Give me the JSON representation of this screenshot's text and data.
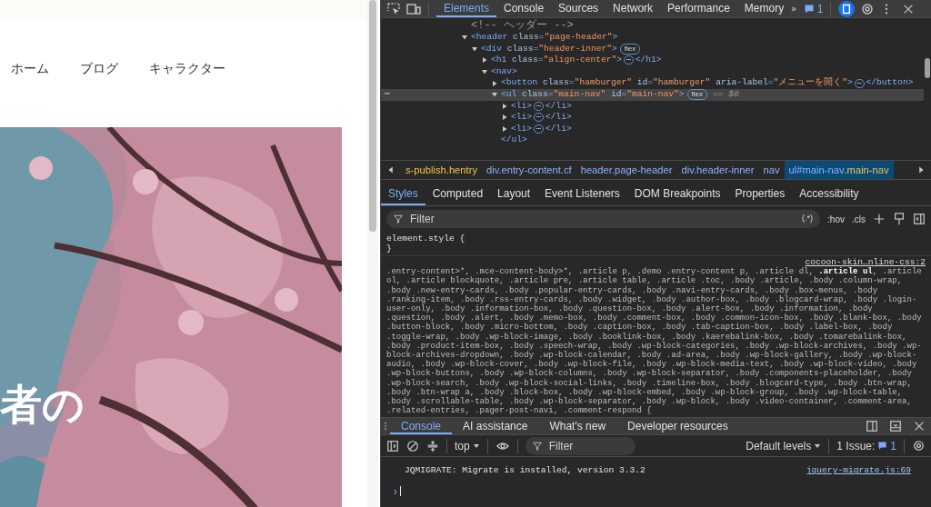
{
  "page": {
    "nav_items": [
      "ホーム",
      "ブログ",
      "キャラクター"
    ],
    "hero": {
      "kind": "picture",
      "title": "者の"
    }
  },
  "devtools": {
    "main_tabs": [
      {
        "label": "Elements",
        "selected": true
      },
      {
        "label": "Console",
        "selected": false
      },
      {
        "label": "Sources",
        "selected": false
      },
      {
        "label": "Network",
        "selected": false
      },
      {
        "label": "Performance",
        "selected": false
      },
      {
        "label": "Memory",
        "selected": false
      }
    ],
    "more_tabs": "»",
    "issues_count": "1",
    "dom_tree": [
      {
        "open": "<!-- ヘッダー -->",
        "kind": "comment"
      },
      {
        "open": "<header class=\"page-header\">",
        "kind": "element",
        "expanded": true,
        "selected": false,
        "children": [
          {
            "open": "<div class=\"header-inner\">",
            "kind": "element",
            "expanded": true,
            "selected": false,
            "badge": "flex",
            "children": [
              {
                "open": "<h1 class=\"align-center\">",
                "kind": "element",
                "expanded": false,
                "selected": false,
                "more": "⋯",
                "end": "</h1>"
              },
              {
                "open": "<nav>",
                "kind": "element",
                "expanded": true,
                "selected": false,
                "children": [
                  {
                    "open": "<button class=\"hamburger\" id=\"hamburger\" aria-label=\"メニューを開く\">",
                    "kind": "element",
                    "expanded": false,
                    "selected": false,
                    "more": "⋯",
                    "end": "</button>"
                  },
                  {
                    "open": "<ul class=\"main-nav\" id=\"main-nav\">",
                    "kind": "element",
                    "expanded": true,
                    "selected": true,
                    "gutter": "⋯",
                    "badge": "flex",
                    "suffix": "== $0",
                    "close": "</ul>",
                    "children": [
                      {
                        "open": "<li>",
                        "kind": "element",
                        "expanded": false,
                        "selected": false,
                        "more": "⋯",
                        "end": "</li>"
                      },
                      {
                        "open": "<li>",
                        "kind": "element",
                        "expanded": false,
                        "selected": false,
                        "more": "⋯",
                        "end": "</li>"
                      },
                      {
                        "open": "<li>",
                        "kind": "element",
                        "expanded": false,
                        "selected": false,
                        "more": "⋯",
                        "end": "</li>"
                      }
                    ]
                  }
                ]
              }
            ]
          }
        ]
      }
    ],
    "breadcrumbs": [
      {
        "cls": "s-publish.hentry",
        "selected": false
      },
      {
        "tag": "div.entry-content.cf",
        "selected": false
      },
      {
        "tag": "header.page-header",
        "selected": false
      },
      {
        "tag": "div.header-inner",
        "selected": false
      },
      {
        "tag": "nav",
        "selected": false
      },
      {
        "tag": "ul#main-nav",
        "cls": ".main-nav",
        "selected": true
      }
    ],
    "side_tabs": [
      {
        "label": "Styles",
        "selected": true
      },
      {
        "label": "Computed",
        "selected": false
      },
      {
        "label": "Layout",
        "selected": false
      },
      {
        "label": "Event Listeners",
        "selected": false
      },
      {
        "label": "DOM Breakpoints",
        "selected": false
      },
      {
        "label": "Properties",
        "selected": false
      },
      {
        "label": "Accessibility",
        "selected": false
      }
    ],
    "styles_filter": {
      "placeholder": "Filter",
      "regex": "(.*)",
      "hov": ":hov",
      "cls": ".cls"
    },
    "element_style": {
      "open": "element.style {",
      "close": "}"
    },
    "rule": {
      "selector_parts": [
        {
          "text": ".entry-content>*, .mce-content-body>*, .article p, .demo .entry-content p, .article dl, ",
          "bold": false
        },
        {
          "text": ".article ul",
          "bold": true
        },
        {
          "text": ", .article ol, .article blockquote, .article pre, .article table, .article .toc, .body .article, .body .column-wrap, .body .new-entry-cards, .body .popular-entry-cards, .body .navi-entry-cards, .body .box-menus, .body .ranking-item, .body .rss-entry-cards, .body .widget, .body .author-box, .body .blogcard-wrap, .body .login-user-only, .body .information-box, .body .question-box, .body .alert-box, .body .information, .body .question, .body .alert, .body .memo-box, .body .comment-box, .body .common-icon-box, .body .blank-box, .body .button-block, .body .micro-bottom, .body .caption-box, .body .tab-caption-box, .body .label-box, .body .toggle-wrap, .body .wp-block-image, .body .booklink-box, .body .kaerebalink-box, .body .tomarebalink-box, .body .product-item-box, .body .speech-wrap, .body .wp-block-categories, .body .wp-block-archives, .body .wp-block-archives-dropdown, .body .wp-block-calendar, .body .ad-area, .body .wp-block-gallery, .body .wp-block-audio, .body .wp-block-cover, .body .wp-block-file, .body .wp-block-media-text, .body .wp-block-video, .body .wp-block-buttons, .body .wp-block-columns, .body .wp-block-separator, .body .components-placeholder, .body .wp-block-search, .body .wp-block-social-links, .body .timeline-box, .body .blogcard-type, .body .btn-wrap, .body .btn-wrap a, .body .block-box, .body .wp-block-embed, .body .wp-block-group, .body .wp-block-table, .body .scrollable-table, .body .wp-block-separator, .body .wp-block, .body .video-container, .comment-area, .related-entries, .pager-post-navi, .comment-respond {",
          "bold": false
        }
      ],
      "source": "cocoon-skin…nline-css:2"
    },
    "drawer_tabs": [
      {
        "label": "Console",
        "selected": true
      },
      {
        "label": "AI assistance",
        "selected": false
      },
      {
        "label": "What's new",
        "selected": false
      },
      {
        "label": "Developer resources",
        "selected": false
      }
    ],
    "console_toolbar": {
      "context": "top",
      "filter_placeholder": "Filter",
      "levels": "Default levels",
      "issues_label": "1 Issue:",
      "issues_count": "1"
    },
    "messages": [
      {
        "text": "JQMIGRATE: Migrate is installed, version 3.3.2",
        "source": "jquery-migrate.js:69"
      }
    ],
    "prompt": "›"
  }
}
